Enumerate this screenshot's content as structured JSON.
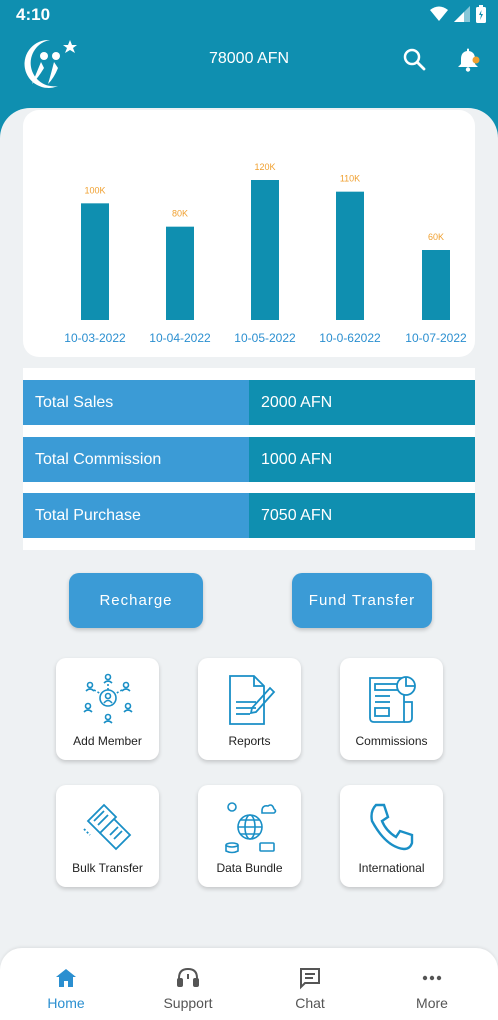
{
  "status_bar": {
    "time": "4:10"
  },
  "header": {
    "balance": "78000 AFN"
  },
  "chart_data": {
    "type": "bar",
    "categories": [
      "10-03-2022",
      "10-04-2022",
      "10-05-2022",
      "10-0-62022",
      "10-07-2022"
    ],
    "values": [
      100,
      80,
      120,
      110,
      60
    ],
    "data_labels": [
      "100K",
      "80K",
      "120K",
      "110K",
      "60K"
    ],
    "ylim": [
      0,
      120
    ],
    "grid": false,
    "colors": {
      "bar": "#0f8fb0",
      "data_label": "#f0a030",
      "tick_label": "#2b8fd0"
    }
  },
  "stats": [
    {
      "label": "Total Sales",
      "value": "2000 AFN"
    },
    {
      "label": "Total Commission",
      "value": "1000 AFN"
    },
    {
      "label": "Total Purchase",
      "value": "7050 AFN"
    }
  ],
  "actions": {
    "recharge": "Recharge",
    "fund_transfer": "Fund Transfer"
  },
  "tiles": [
    {
      "label": "Add Member",
      "icon": "people-network-icon"
    },
    {
      "label": "Reports",
      "icon": "report-pen-icon"
    },
    {
      "label": "Commissions",
      "icon": "newspaper-chart-icon"
    },
    {
      "label": "Bulk Transfer",
      "icon": "bulk-papers-icon"
    },
    {
      "label": "Data Bundle",
      "icon": "globe-data-icon"
    },
    {
      "label": "International",
      "icon": "phone-icon"
    }
  ],
  "nav": [
    {
      "label": "Home",
      "icon": "home-icon",
      "active": true
    },
    {
      "label": "Support",
      "icon": "headset-icon",
      "active": false
    },
    {
      "label": "Chat",
      "icon": "chat-icon",
      "active": false
    },
    {
      "label": "More",
      "icon": "more-dots-icon",
      "active": false
    }
  ],
  "theme": {
    "primary": "#0f8fb0",
    "accent": "#3b9bd6",
    "bell_dot": "#f0a030"
  }
}
